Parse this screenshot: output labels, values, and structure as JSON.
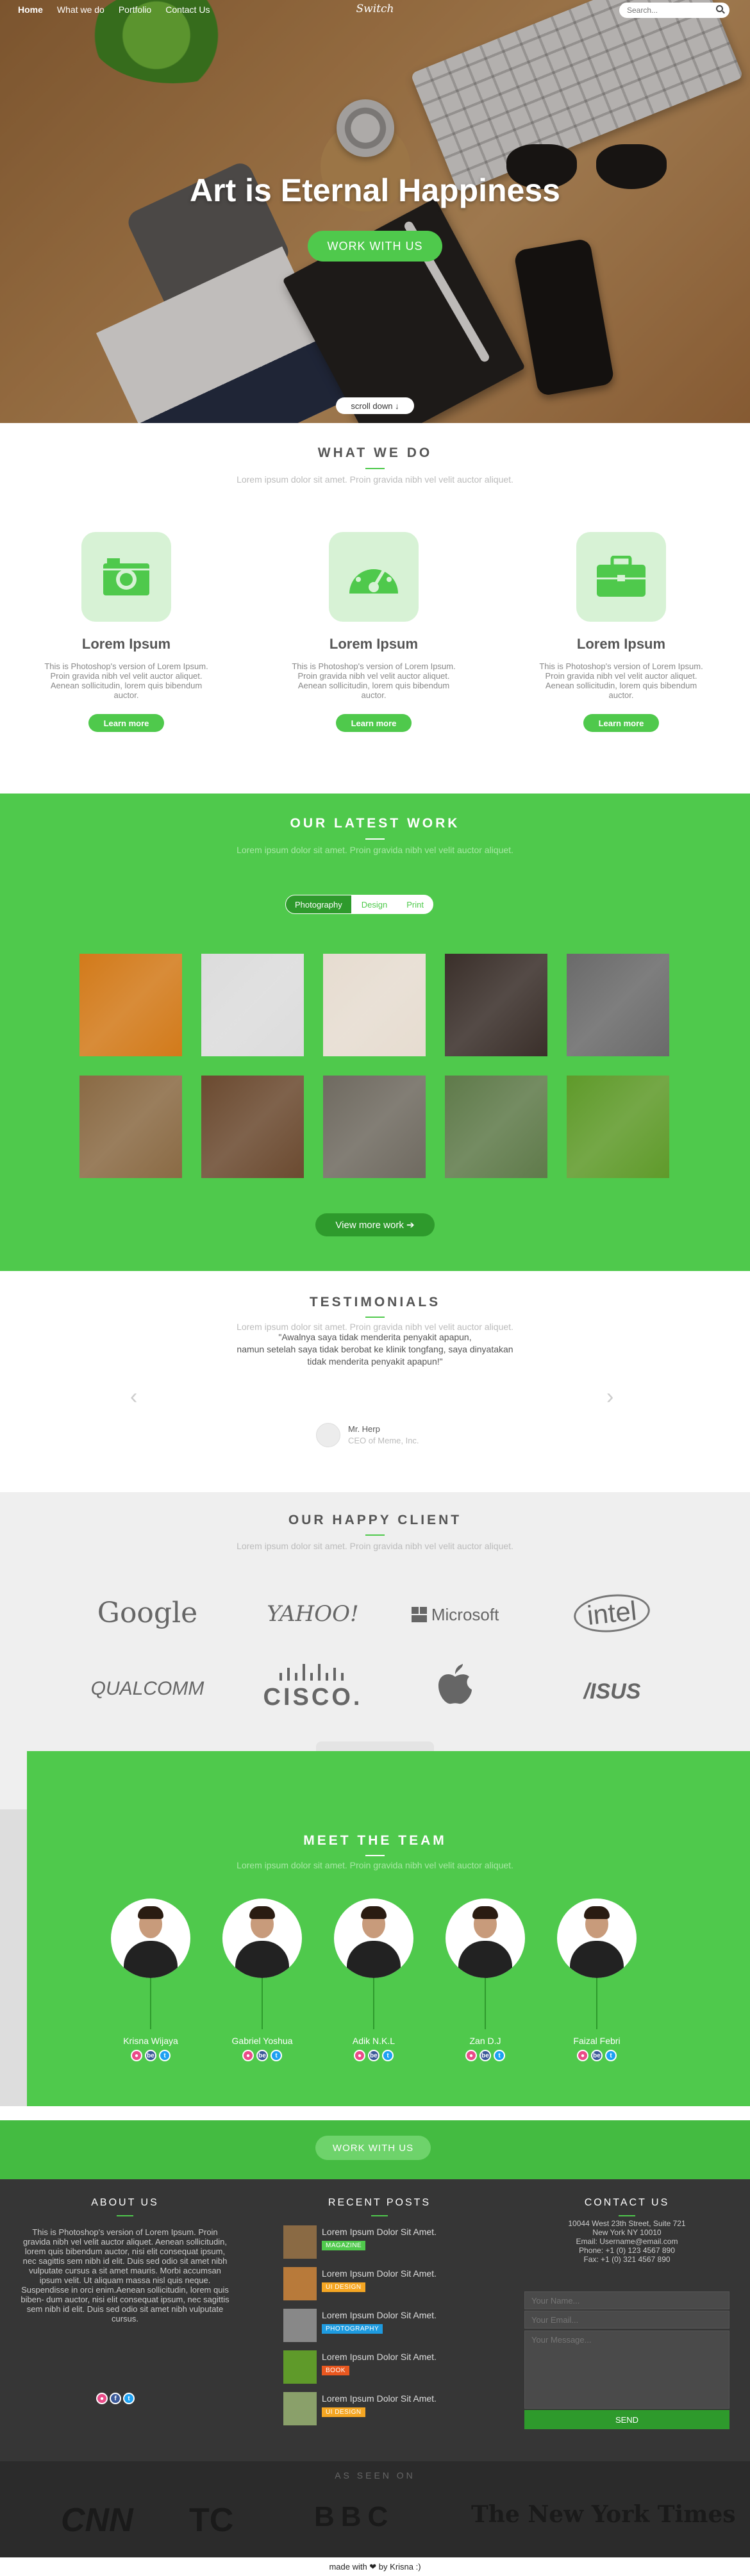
{
  "nav": {
    "links": [
      "Home",
      "What we do",
      "Portfolio",
      "Contact Us"
    ],
    "logo": "Switch",
    "search_placeholder": "Search..."
  },
  "hero": {
    "title": "Art is Eternal Happiness",
    "cta": "WORK WITH US",
    "scroll": "scroll down ↓"
  },
  "what_we_do": {
    "title": "WHAT WE DO",
    "subtitle": "Lorem ipsum dolor sit amet. Proin gravida nibh vel velit auctor aliquet.",
    "services": [
      {
        "icon": "camera-icon",
        "title": "Lorem Ipsum",
        "text": "This is Photoshop's version of Lorem Ipsum. Proin gravida nibh vel velit auctor aliquet. Aenean sollicitudin, lorem quis bibendum auctor.",
        "button": "Learn more"
      },
      {
        "icon": "speedometer-icon",
        "title": "Lorem Ipsum",
        "text": "This is Photoshop's version of Lorem Ipsum. Proin gravida nibh vel velit auctor aliquet. Aenean sollicitudin, lorem quis bibendum auctor.",
        "button": "Learn more"
      },
      {
        "icon": "briefcase-icon",
        "title": "Lorem Ipsum",
        "text": "This is Photoshop's version of Lorem Ipsum. Proin gravida nibh vel velit auctor aliquet. Aenean sollicitudin, lorem quis bibendum auctor.",
        "button": "Learn more"
      }
    ]
  },
  "latest_work": {
    "title": "OUR LATEST WORK",
    "subtitle": "Lorem ipsum dolor sit amet. Proin gravida nibh vel velit auctor aliquet.",
    "filters": [
      "Photography",
      "Design",
      "Print"
    ],
    "active_filter": "Photography",
    "thumb_colors": [
      "#d27a1a",
      "#dcdcdc",
      "#e6dcd0",
      "#3a2f2a",
      "#6a6a6a",
      "#8a6a44",
      "#6b4a30",
      "#6f6a60",
      "#5f7a4a",
      "#5f9a2a"
    ],
    "button": "View more work ➔"
  },
  "testimonials": {
    "title": "TESTIMONIALS",
    "subtitle": "Lorem ipsum dolor sit amet. Proin gravida nibh vel velit auctor aliquet.",
    "quote_lines": [
      "\"Awalnya saya tidak menderita penyakit apapun,",
      "namun setelah saya tidak berobat ke klinik tongfang, saya dinyatakan",
      "tidak menderita penyakit apapun!\""
    ],
    "name": "Mr. Herp",
    "role": "CEO of Meme, Inc.",
    "prev": "‹",
    "next": "›"
  },
  "clients": {
    "title": "OUR HAPPY CLIENT",
    "subtitle": "Lorem ipsum dolor sit amet. Proin gravida nibh vel velit auctor aliquet.",
    "logos": [
      "Google",
      "YAHOO!",
      "Microsoft",
      "intel",
      "QUALCOMM",
      "CISCO.",
      "",
      "/ISUS"
    ]
  },
  "team": {
    "title": "MEET THE TEAM",
    "subtitle": "Lorem ipsum dolor sit amet. Proin gravida nibh vel velit auctor aliquet.",
    "members": [
      "Krisna Wijaya",
      "Gabriel Yoshua",
      "Adik N.K.L",
      "Zan D.J",
      "Faizal Febri"
    ]
  },
  "cta": {
    "label": "WORK WITH US"
  },
  "footer": {
    "about_title": "ABOUT US",
    "about_text": "This is Photoshop's version of Lorem Ipsum. Proin gravida nibh vel velit auctor aliquet. Aenean sollicitudin, lorem quis bibendum auctor, nisi elit consequat ipsum, nec sagittis sem nibh id elit. Duis sed odio sit amet nibh vulputate cursus a sit amet mauris. Morbi accumsan ipsum velit. Ut aliquam massa nisl quis neque. Suspendisse in orci enim.Aenean sollicitudin, lorem quis biben- dum auctor, nisi elit consequat ipsum, nec sagittis sem nibh id elit. Duis sed odio sit amet nibh vulputate cursus.",
    "posts_title": "RECENT POSTS",
    "posts": [
      {
        "title": "Lorem Ipsum Dolor Sit Amet.",
        "tag": "MAGAZINE",
        "color": "#4fc94c"
      },
      {
        "title": "Lorem Ipsum Dolor Sit Amet.",
        "tag": "UI DESIGN",
        "color": "#f5a623"
      },
      {
        "title": "Lorem Ipsum Dolor Sit Amet.",
        "tag": "PHOTOGRAPHY",
        "color": "#1e9be0"
      },
      {
        "title": "Lorem Ipsum Dolor Sit Amet.",
        "tag": "BOOK",
        "color": "#e8571f"
      },
      {
        "title": "Lorem Ipsum Dolor Sit Amet.",
        "tag": "UI DESIGN",
        "color": "#f5a623"
      }
    ],
    "contact_title": "CONTACT US",
    "address_lines": [
      "10044 West 23th Street, Suite 721",
      "New York NY 10010",
      "Email: Username@email.com",
      "Phone: +1 (0) 123 4567 890",
      "Fax: +1 (0) 321 4567 890"
    ],
    "name_placeholder": "Your Name...",
    "email_placeholder": "Your Email...",
    "message_placeholder": "Your Message...",
    "send": "SEND"
  },
  "as_seen_on": {
    "title": "AS SEEN ON",
    "press": [
      "CNN",
      "TC",
      "BBC",
      "The New York Times"
    ]
  },
  "copyright": "made with ❤ by Krisna :)"
}
